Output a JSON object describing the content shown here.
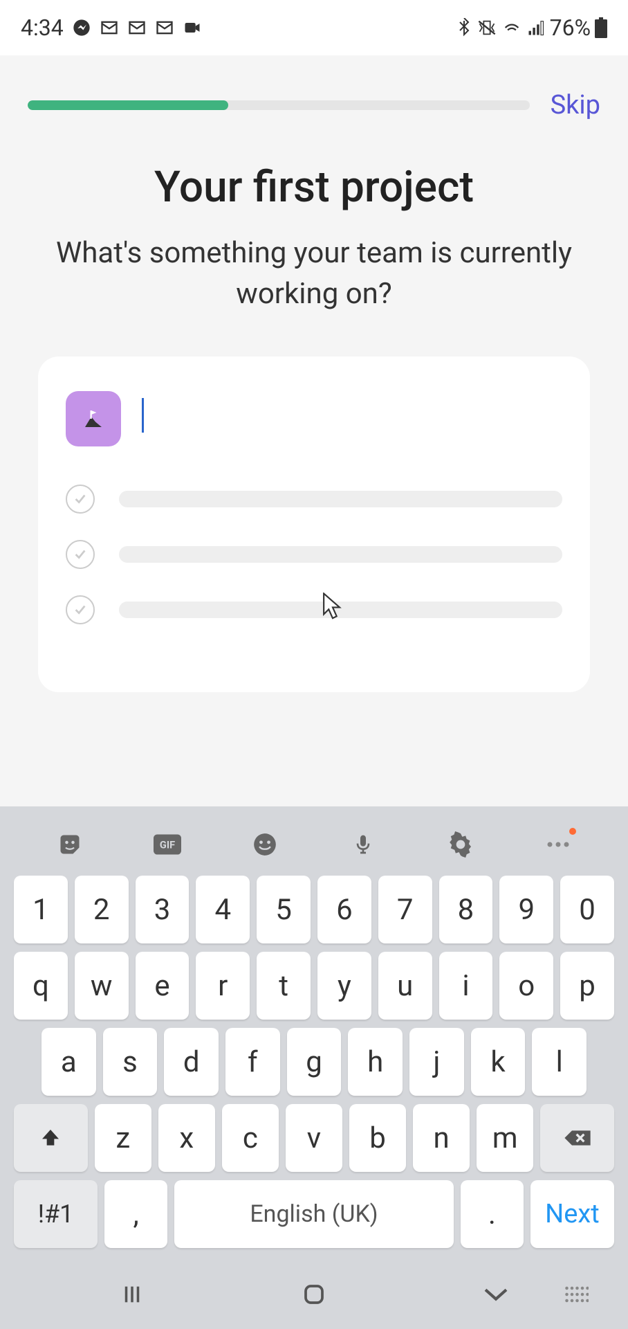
{
  "statusBar": {
    "time": "4:34",
    "battery": "76%"
  },
  "main": {
    "skipLabel": "Skip",
    "heading": "Your first project",
    "subheading": "What's something your team is currently working on?"
  },
  "keyboard": {
    "row1": [
      "1",
      "2",
      "3",
      "4",
      "5",
      "6",
      "7",
      "8",
      "9",
      "0"
    ],
    "row2": [
      "q",
      "w",
      "e",
      "r",
      "t",
      "y",
      "u",
      "i",
      "o",
      "p"
    ],
    "row3": [
      "a",
      "s",
      "d",
      "f",
      "g",
      "h",
      "j",
      "k",
      "l"
    ],
    "row4": [
      "z",
      "x",
      "c",
      "v",
      "b",
      "n",
      "m"
    ],
    "symKey": "!#1",
    "comma": ",",
    "space": "English (UK)",
    "period": ".",
    "action": "Next"
  }
}
